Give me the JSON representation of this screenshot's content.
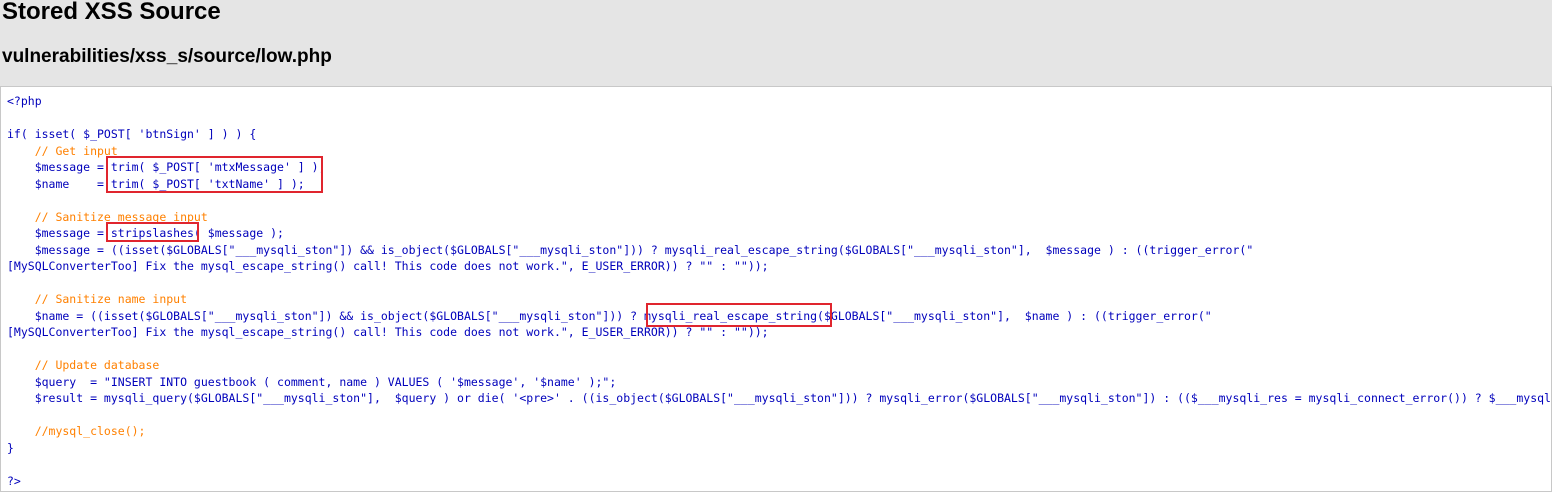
{
  "page": {
    "title": "Stored XSS Source",
    "path": "vulnerabilities/xss_s/source/low.php"
  },
  "code": {
    "lines": [
      "<?php",
      "",
      "if( isset( $_POST[ 'btnSign' ] ) ) {",
      "    // Get input",
      "    $message = trim( $_POST[ 'mtxMessage' ] );",
      "    $name    = trim( $_POST[ 'txtName' ] );",
      "",
      "    // Sanitize message input",
      "    $message = stripslashes( $message );",
      "    $message = ((isset($GLOBALS[\"___mysqli_ston\"]) && is_object($GLOBALS[\"___mysqli_ston\"])) ? mysqli_real_escape_string($GLOBALS[\"___mysqli_ston\"],  $message ) : ((trigger_error(\"",
      "[MySQLConverterToo] Fix the mysql_escape_string() call! This code does not work.\", E_USER_ERROR)) ? \"\" : \"\"));",
      "",
      "    // Sanitize name input",
      "    $name = ((isset($GLOBALS[\"___mysqli_ston\"]) && is_object($GLOBALS[\"___mysqli_ston\"])) ? mysqli_real_escape_string($GLOBALS[\"___mysqli_ston\"],  $name ) : ((trigger_error(\"",
      "[MySQLConverterToo] Fix the mysql_escape_string() call! This code does not work.\", E_USER_ERROR)) ? \"\" : \"\"));",
      "",
      "    // Update database",
      "    $query  = \"INSERT INTO guestbook ( comment, name ) VALUES ( '$message', '$name' );\";",
      "    $result = mysqli_query($GLOBALS[\"___mysqli_ston\"],  $query ) or die( '<pre>' . ((is_object($GLOBALS[\"___mysqli_ston\"])) ? mysqli_error($GLOBALS[\"___mysqli_ston\"]) : (($___mysqli_res = mysqli_connect_error()) ? $___mysqli_res : false)) . '</pre>' );",
      "",
      "    //mysql_close();",
      "}",
      "",
      "?>"
    ]
  },
  "highlights": [
    "trim-input-box",
    "stripslashes-box",
    "mysqli-real-escape-string-box"
  ],
  "colors": {
    "highlight": "#e0252e",
    "keyword": "#0000bb",
    "comment": "#ff8000",
    "string": "#dd0000",
    "default": "#007700"
  }
}
